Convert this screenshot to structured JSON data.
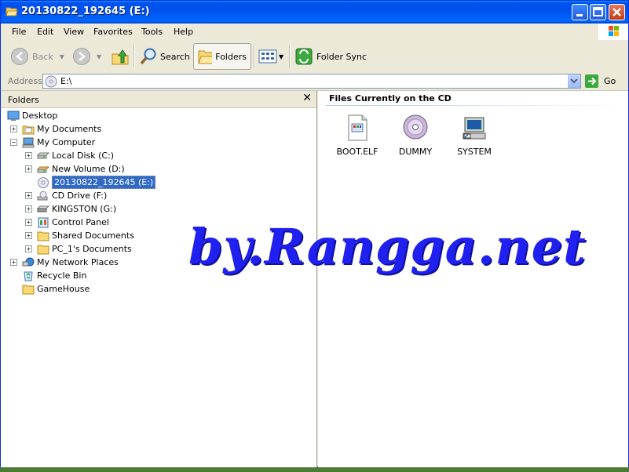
{
  "window": {
    "title": "20130822_192645 (E:)",
    "colors": {
      "titlebar": "#0054e3",
      "selection": "#316ac5",
      "watermark": "#2020f0"
    }
  },
  "menu": {
    "items": [
      "File",
      "Edit",
      "View",
      "Favorites",
      "Tools",
      "Help"
    ]
  },
  "toolbar": {
    "back_label": "Back",
    "search_label": "Search",
    "folders_label": "Folders",
    "folder_sync_label": "Folder Sync"
  },
  "address": {
    "label": "Address",
    "value": "E:\\",
    "go_label": "Go"
  },
  "folders_pane": {
    "title": "Folders",
    "close_glyph": "✕",
    "items": [
      {
        "label": "Desktop",
        "icon": "desktop-icon"
      },
      {
        "label": "My Documents",
        "icon": "my-documents-icon"
      },
      {
        "label": "My Computer",
        "icon": "my-computer-icon"
      },
      {
        "label": "Local Disk (C:)",
        "icon": "hard-disk-icon"
      },
      {
        "label": "New Volume (D:)",
        "icon": "hard-disk-icon"
      },
      {
        "label": "20130822_192645 (E:)",
        "icon": "cd-icon"
      },
      {
        "label": "CD Drive (F:)",
        "icon": "cd-drive-icon"
      },
      {
        "label": "KINGSTON (G:)",
        "icon": "removable-disk-icon"
      },
      {
        "label": "Control Panel",
        "icon": "control-panel-icon"
      },
      {
        "label": "Shared Documents",
        "icon": "folder-icon"
      },
      {
        "label": "PC_1's Documents",
        "icon": "folder-icon"
      },
      {
        "label": "My Network Places",
        "icon": "network-icon"
      },
      {
        "label": "Recycle Bin",
        "icon": "recycle-bin-icon"
      },
      {
        "label": "GameHouse",
        "icon": "folder-icon"
      }
    ]
  },
  "content": {
    "header": "Files Currently on the CD",
    "files": [
      {
        "label": "BOOT.ELF",
        "icon": "file-icon"
      },
      {
        "label": "DUMMY",
        "icon": "disc-icon"
      },
      {
        "label": "SYSTEM",
        "icon": "system-icon"
      }
    ]
  },
  "watermark": "by.Rangga.net"
}
